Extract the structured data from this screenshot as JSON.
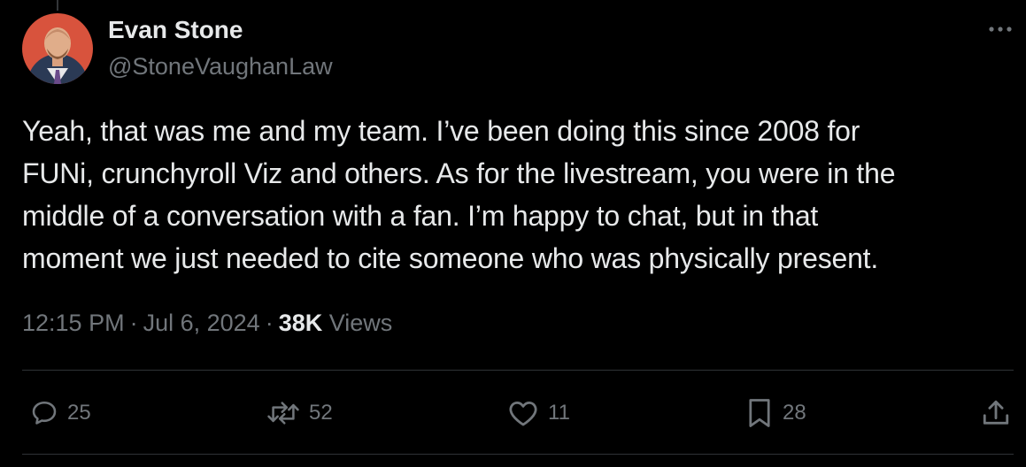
{
  "author": {
    "display_name": "Evan Stone",
    "handle": "@StoneVaughanLaw"
  },
  "tweet": {
    "text": "Yeah, that was me and my team. I’ve been doing this since 2008 for\nFUNi, crunchyroll Viz and others. As for the livestream, you were in the\nmiddle of a conversation with a fan. I’m happy to chat, but in that\nmoment we just needed to cite someone who was physically present."
  },
  "meta": {
    "time": "12:15 PM",
    "separator": "·",
    "date": "Jul 6, 2024",
    "views_count": "38K",
    "views_label": "Views"
  },
  "actions": {
    "replies": "25",
    "reposts": "52",
    "likes": "11",
    "bookmarks": "28"
  },
  "icons": {
    "more": "more-horizontal-icon",
    "reply": "reply-bubble-icon",
    "repost": "repost-arrows-icon",
    "like": "heart-icon",
    "bookmark": "bookmark-icon",
    "share": "share-upload-icon"
  },
  "colors": {
    "background": "#000000",
    "primary_text": "#e7e9ea",
    "secondary_text": "#71767b",
    "divider": "#2f3336"
  }
}
